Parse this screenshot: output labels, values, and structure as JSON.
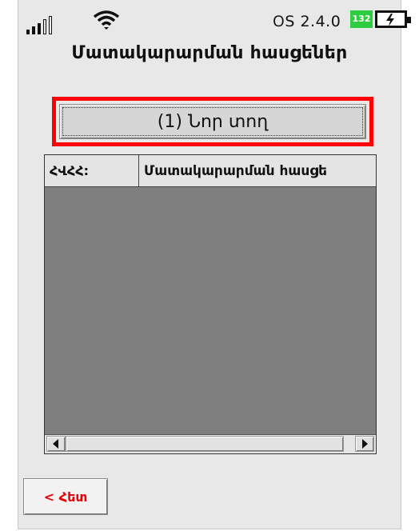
{
  "status": {
    "os_version": "ᱛS 2.4.0",
    "battery_percent": "132",
    "signal_icon": "signal-icon",
    "wifi_icon": "wifi-icon",
    "battery_icon": "battery-charging-icon",
    "battery_color": "#2ecc40"
  },
  "page": {
    "title": "Մատակարարման հասցեներ"
  },
  "new_row_button": {
    "label": "(1) Նոր տող",
    "focus_color": "#ff0000"
  },
  "grid": {
    "columns": [
      "ՀՎՀՀ:",
      "Մատակարարման հասցե"
    ],
    "rows": []
  },
  "back_button": {
    "label": "< Հետ",
    "color": "#e8000b"
  }
}
